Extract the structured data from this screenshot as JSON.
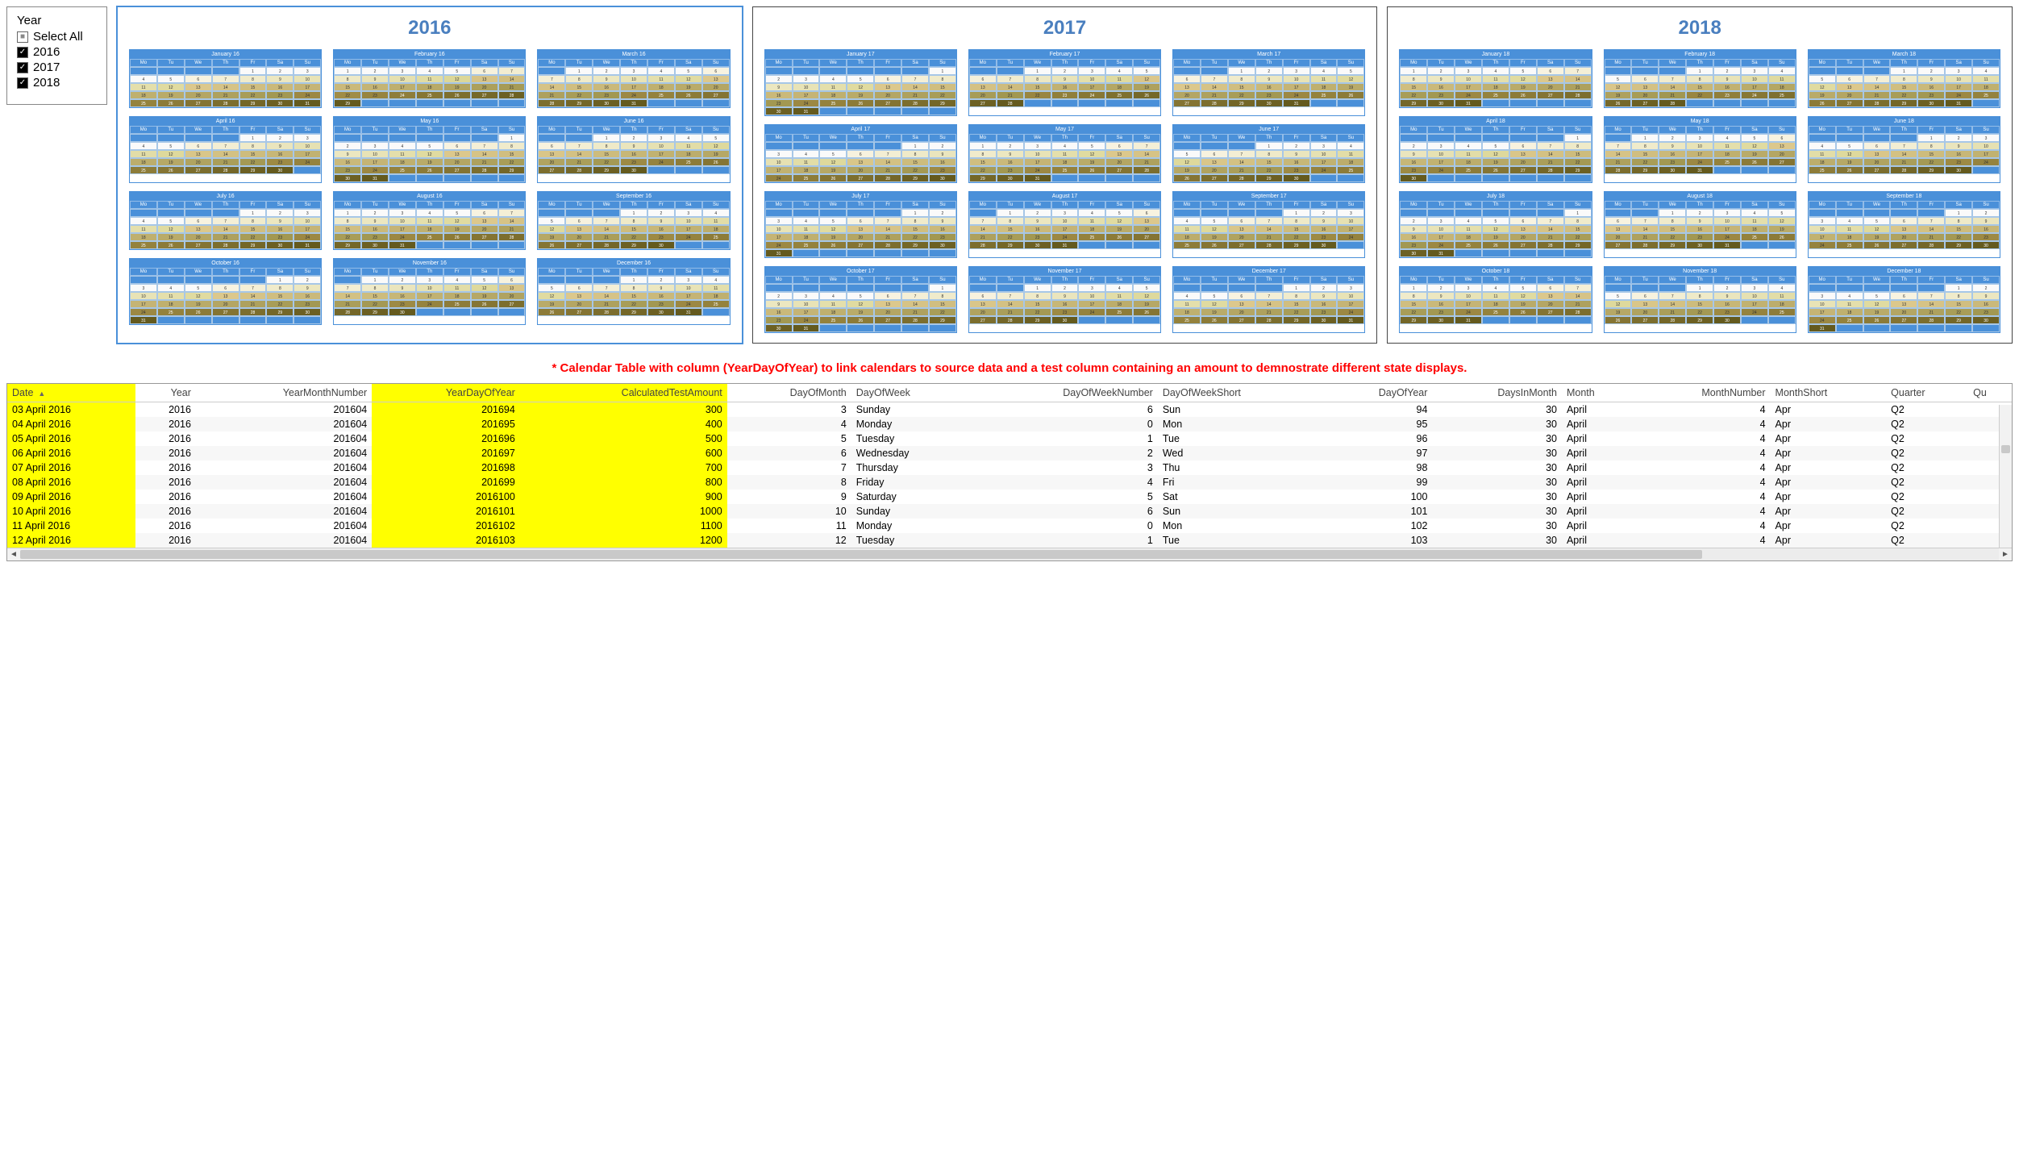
{
  "slicer": {
    "title": "Year",
    "selectAll": "Select All",
    "items": [
      "2016",
      "2017",
      "2018"
    ]
  },
  "years": [
    2016,
    2017,
    2018
  ],
  "dow": [
    "Mo",
    "Tu",
    "We",
    "Th",
    "Fr",
    "Sa",
    "Su"
  ],
  "monthNames": [
    "January",
    "February",
    "March",
    "April",
    "May",
    "June",
    "July",
    "August",
    "September",
    "October",
    "November",
    "December"
  ],
  "monthStarts": {
    "2016": [
      4,
      0,
      1,
      4,
      6,
      2,
      4,
      0,
      3,
      5,
      1,
      3
    ],
    "2017": [
      6,
      2,
      2,
      5,
      0,
      3,
      5,
      1,
      4,
      6,
      2,
      4
    ],
    "2018": [
      0,
      3,
      3,
      6,
      1,
      4,
      6,
      2,
      5,
      0,
      3,
      5
    ]
  },
  "monthLen": {
    "2016": [
      31,
      29,
      31,
      30,
      31,
      30,
      31,
      31,
      30,
      31,
      30,
      31
    ],
    "2017": [
      31,
      28,
      31,
      30,
      31,
      30,
      31,
      31,
      30,
      31,
      30,
      31
    ],
    "2018": [
      31,
      28,
      31,
      30,
      31,
      30,
      31,
      31,
      30,
      31,
      30,
      31
    ]
  },
  "footnote": "* Calendar Table with column (YearDayOfYear) to link calendars to source data and a test column containing an amount to demnostrate different state displays.",
  "table": {
    "headers": [
      "Date",
      "Year",
      "YearMonthNumber",
      "YearDayOfYear",
      "CalculatedTestAmount",
      "DayOfMonth",
      "DayOfWeek",
      "DayOfWeekNumber",
      "DayOfWeekShort",
      "DayOfYear",
      "DaysInMonth",
      "Month",
      "MonthNumber",
      "MonthShort",
      "Quarter",
      "Qu"
    ],
    "hlCols": [
      0,
      3,
      4
    ],
    "numCols": [
      1,
      2,
      3,
      4,
      5,
      7,
      9,
      10,
      12
    ],
    "rows": [
      [
        "03 April 2016",
        "2016",
        "201604",
        "201694",
        "300",
        "3",
        "Sunday",
        "6",
        "Sun",
        "94",
        "30",
        "April",
        "4",
        "Apr",
        "Q2",
        ""
      ],
      [
        "04 April 2016",
        "2016",
        "201604",
        "201695",
        "400",
        "4",
        "Monday",
        "0",
        "Mon",
        "95",
        "30",
        "April",
        "4",
        "Apr",
        "Q2",
        ""
      ],
      [
        "05 April 2016",
        "2016",
        "201604",
        "201696",
        "500",
        "5",
        "Tuesday",
        "1",
        "Tue",
        "96",
        "30",
        "April",
        "4",
        "Apr",
        "Q2",
        ""
      ],
      [
        "06 April 2016",
        "2016",
        "201604",
        "201697",
        "600",
        "6",
        "Wednesday",
        "2",
        "Wed",
        "97",
        "30",
        "April",
        "4",
        "Apr",
        "Q2",
        ""
      ],
      [
        "07 April 2016",
        "2016",
        "201604",
        "201698",
        "700",
        "7",
        "Thursday",
        "3",
        "Thu",
        "98",
        "30",
        "April",
        "4",
        "Apr",
        "Q2",
        ""
      ],
      [
        "08 April 2016",
        "2016",
        "201604",
        "201699",
        "800",
        "8",
        "Friday",
        "4",
        "Fri",
        "99",
        "30",
        "April",
        "4",
        "Apr",
        "Q2",
        ""
      ],
      [
        "09 April 2016",
        "2016",
        "201604",
        "2016100",
        "900",
        "9",
        "Saturday",
        "5",
        "Sat",
        "100",
        "30",
        "April",
        "4",
        "Apr",
        "Q2",
        ""
      ],
      [
        "10 April 2016",
        "2016",
        "201604",
        "2016101",
        "1000",
        "10",
        "Sunday",
        "6",
        "Sun",
        "101",
        "30",
        "April",
        "4",
        "Apr",
        "Q2",
        ""
      ],
      [
        "11 April 2016",
        "2016",
        "201604",
        "2016102",
        "1100",
        "11",
        "Monday",
        "0",
        "Mon",
        "102",
        "30",
        "April",
        "4",
        "Apr",
        "Q2",
        ""
      ],
      [
        "12 April 2016",
        "2016",
        "201604",
        "2016103",
        "1200",
        "12",
        "Tuesday",
        "1",
        "Tue",
        "103",
        "30",
        "April",
        "4",
        "Apr",
        "Q2",
        ""
      ]
    ]
  }
}
